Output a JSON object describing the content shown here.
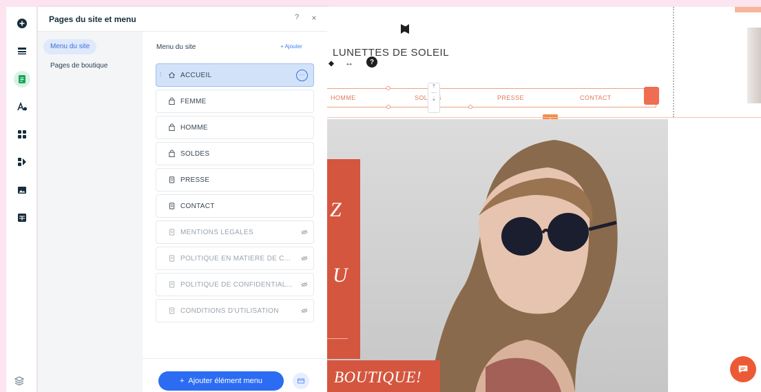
{
  "panel": {
    "title": "Pages du site et menu",
    "help": "?",
    "close": "×",
    "subnav": [
      {
        "label": "Menu du site",
        "selected": true
      },
      {
        "label": "Pages de boutique",
        "selected": false
      }
    ],
    "menu_title": "Menu du site",
    "add_label": "+ Ajouter",
    "items": [
      {
        "label": "ACCUEIL",
        "icon": "home-icon",
        "selected": true,
        "hidden": false
      },
      {
        "label": "FEMME",
        "icon": "bag-icon",
        "selected": false,
        "hidden": false
      },
      {
        "label": "HOMME",
        "icon": "bag-icon",
        "selected": false,
        "hidden": false
      },
      {
        "label": "SOLDES",
        "icon": "bag-icon",
        "selected": false,
        "hidden": false
      },
      {
        "label": "PRESSE",
        "icon": "page-icon",
        "selected": false,
        "hidden": false
      },
      {
        "label": "CONTACT",
        "icon": "page-icon",
        "selected": false,
        "hidden": false
      },
      {
        "label": "MENTIONS LÉGALES",
        "icon": "page-icon",
        "selected": false,
        "hidden": true
      },
      {
        "label": "POLITIQUE EN MATIÈRE DE C...",
        "icon": "page-icon",
        "selected": false,
        "hidden": true
      },
      {
        "label": "POLITIQUE DE CONFIDENTIAL...",
        "icon": "page-icon",
        "selected": false,
        "hidden": true
      },
      {
        "label": "CONDITIONS D'UTILISATION",
        "icon": "page-icon",
        "selected": false,
        "hidden": true
      }
    ],
    "add_element_label": "Ajouter élément menu"
  },
  "rail": {
    "icons": [
      "add-icon",
      "menus-icon",
      "pages-icon",
      "theme-icon",
      "apps-icon",
      "app-market-icon",
      "media-icon",
      "cms-icon"
    ],
    "bottom_icon": "layers-icon"
  },
  "site": {
    "title": "LUNETTES DE SOLEIL",
    "nav": [
      "HOMME",
      "SOLDES",
      "PRESSE",
      "CONTACT"
    ],
    "hero_letters": [
      "Z",
      "U"
    ],
    "hero_banner": "BOUTIQUE!"
  },
  "colors": {
    "primary": "#2b6cf3",
    "accent_red": "#d4563f",
    "active_green": "#d8f3e4"
  }
}
